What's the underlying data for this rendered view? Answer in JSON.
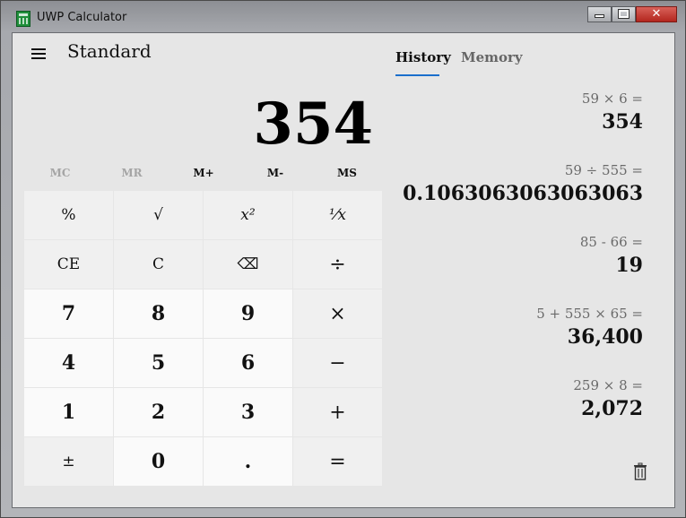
{
  "window": {
    "title": "UWP Calculator",
    "controls": {
      "minimize": "",
      "maximize": "",
      "close": "✕"
    }
  },
  "calculator": {
    "mode": "Standard",
    "display": "354",
    "memory": [
      "MC",
      "MR",
      "M+",
      "M-",
      "MS"
    ],
    "keys": [
      "%",
      "√",
      "x²",
      "⅟x",
      "CE",
      "C",
      "⌫",
      "÷",
      "7",
      "8",
      "9",
      "×",
      "4",
      "5",
      "6",
      "−",
      "1",
      "2",
      "3",
      "+",
      "±",
      "0",
      ".",
      "="
    ]
  },
  "panel": {
    "tabs": [
      "History",
      "Memory"
    ],
    "history": [
      {
        "expr": "59 × 6 =",
        "result": "354"
      },
      {
        "expr": "59 ÷ 555 =",
        "result": "0.1063063063063063"
      },
      {
        "expr": "85 - 66 =",
        "result": "19"
      },
      {
        "expr": "5 + 555 × 65 =",
        "result": "36,400"
      },
      {
        "expr": "259 × 8 =",
        "result": "2,072"
      }
    ]
  }
}
